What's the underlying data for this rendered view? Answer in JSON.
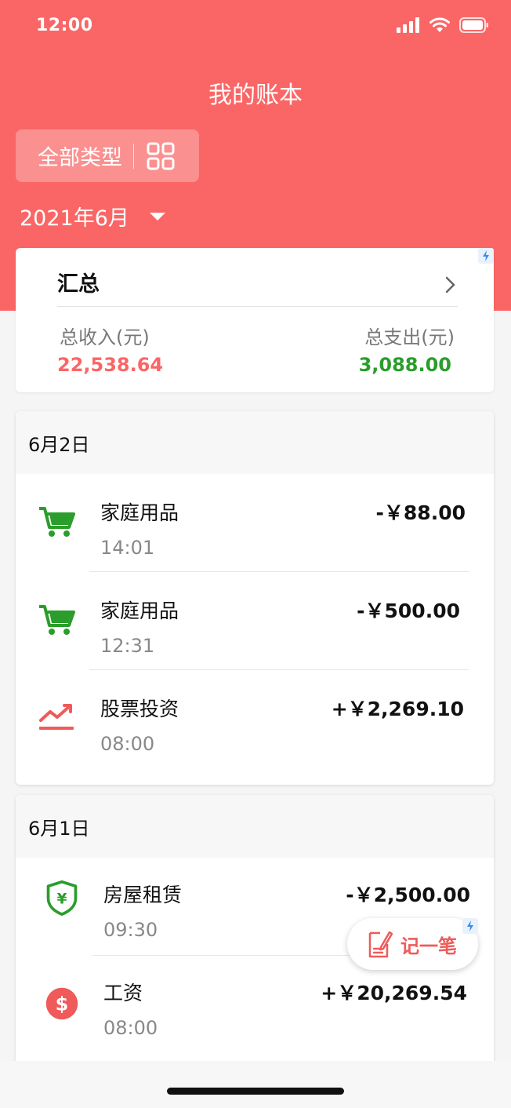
{
  "status_bar": {
    "time": "12:00"
  },
  "header": {
    "title": "我的账本",
    "type_filter_label": "全部类型",
    "month": "2021年6月"
  },
  "summary": {
    "title": "汇总",
    "income_label": "总收入(元)",
    "income_value": "22,538.64",
    "expense_label": "总支出(元)",
    "expense_value": "3,088.00"
  },
  "days": [
    {
      "date": "6月2日",
      "transactions": [
        {
          "name": "家庭用品",
          "time": "14:01",
          "amount": "-￥88.00",
          "icon": "cart-icon"
        },
        {
          "name": "家庭用品",
          "time": "12:31",
          "amount": "-￥500.00",
          "icon": "cart-icon"
        },
        {
          "name": "股票投资",
          "time": "08:00",
          "amount": "+￥2,269.10",
          "icon": "stock-trend-icon"
        }
      ]
    },
    {
      "date": "6月1日",
      "transactions": [
        {
          "name": "房屋租赁",
          "time": "09:30",
          "amount": "-￥2,500.00",
          "icon": "yen-shield-icon"
        },
        {
          "name": "工资",
          "time": "08:00",
          "amount": "+￥20,269.54",
          "icon": "dollar-coin-icon"
        }
      ]
    }
  ],
  "fab": {
    "label": "记一笔"
  },
  "colors": {
    "accent": "#fa6666",
    "income": "#fa6666",
    "expense": "#2a9d2a",
    "category_green": "#2a9d2a"
  }
}
